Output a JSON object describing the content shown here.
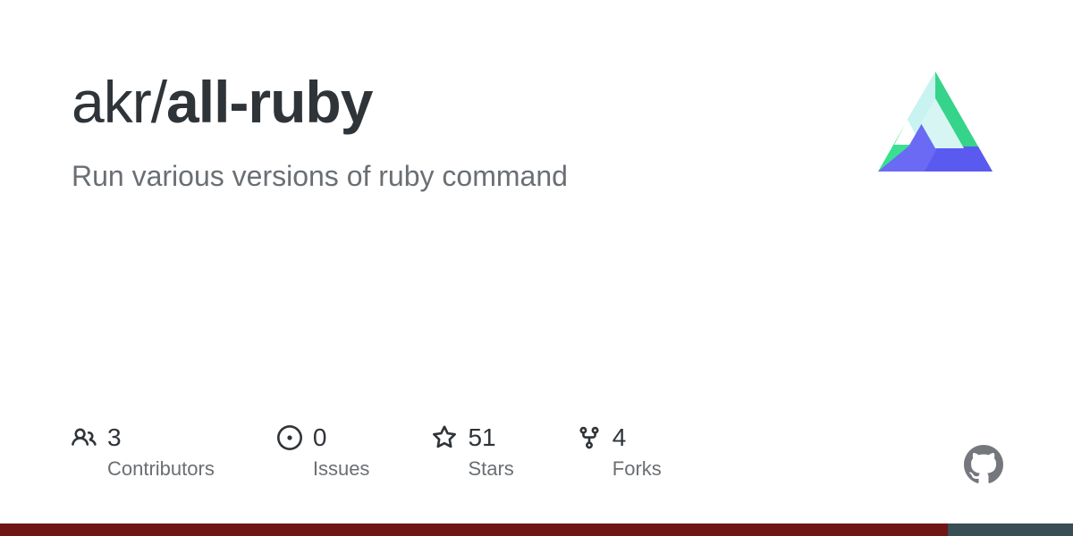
{
  "repo": {
    "owner": "akr",
    "separator": "/",
    "name": "all-ruby",
    "description": "Run various versions of ruby command"
  },
  "stats": {
    "contributors": {
      "value": "3",
      "label": "Contributors"
    },
    "issues": {
      "value": "0",
      "label": "Issues"
    },
    "stars": {
      "value": "51",
      "label": "Stars"
    },
    "forks": {
      "value": "4",
      "label": "Forks"
    }
  },
  "language_bar": [
    {
      "color": "#701516",
      "width": "88.3%"
    },
    {
      "color": "#384d54",
      "width": "11.7%"
    }
  ]
}
